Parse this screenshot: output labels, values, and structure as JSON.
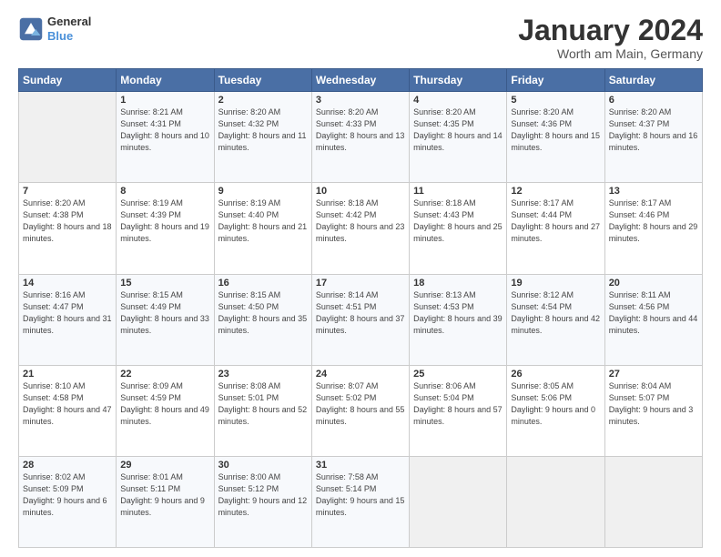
{
  "header": {
    "logo_line1": "General",
    "logo_line2": "Blue",
    "month_title": "January 2024",
    "location": "Worth am Main, Germany"
  },
  "days_of_week": [
    "Sunday",
    "Monday",
    "Tuesday",
    "Wednesday",
    "Thursday",
    "Friday",
    "Saturday"
  ],
  "weeks": [
    [
      {
        "day": "",
        "sunrise": "",
        "sunset": "",
        "daylight": "",
        "empty": true
      },
      {
        "day": "1",
        "sunrise": "Sunrise: 8:21 AM",
        "sunset": "Sunset: 4:31 PM",
        "daylight": "Daylight: 8 hours and 10 minutes."
      },
      {
        "day": "2",
        "sunrise": "Sunrise: 8:20 AM",
        "sunset": "Sunset: 4:32 PM",
        "daylight": "Daylight: 8 hours and 11 minutes."
      },
      {
        "day": "3",
        "sunrise": "Sunrise: 8:20 AM",
        "sunset": "Sunset: 4:33 PM",
        "daylight": "Daylight: 8 hours and 13 minutes."
      },
      {
        "day": "4",
        "sunrise": "Sunrise: 8:20 AM",
        "sunset": "Sunset: 4:35 PM",
        "daylight": "Daylight: 8 hours and 14 minutes."
      },
      {
        "day": "5",
        "sunrise": "Sunrise: 8:20 AM",
        "sunset": "Sunset: 4:36 PM",
        "daylight": "Daylight: 8 hours and 15 minutes."
      },
      {
        "day": "6",
        "sunrise": "Sunrise: 8:20 AM",
        "sunset": "Sunset: 4:37 PM",
        "daylight": "Daylight: 8 hours and 16 minutes."
      }
    ],
    [
      {
        "day": "7",
        "sunrise": "Sunrise: 8:20 AM",
        "sunset": "Sunset: 4:38 PM",
        "daylight": "Daylight: 8 hours and 18 minutes."
      },
      {
        "day": "8",
        "sunrise": "Sunrise: 8:19 AM",
        "sunset": "Sunset: 4:39 PM",
        "daylight": "Daylight: 8 hours and 19 minutes."
      },
      {
        "day": "9",
        "sunrise": "Sunrise: 8:19 AM",
        "sunset": "Sunset: 4:40 PM",
        "daylight": "Daylight: 8 hours and 21 minutes."
      },
      {
        "day": "10",
        "sunrise": "Sunrise: 8:18 AM",
        "sunset": "Sunset: 4:42 PM",
        "daylight": "Daylight: 8 hours and 23 minutes."
      },
      {
        "day": "11",
        "sunrise": "Sunrise: 8:18 AM",
        "sunset": "Sunset: 4:43 PM",
        "daylight": "Daylight: 8 hours and 25 minutes."
      },
      {
        "day": "12",
        "sunrise": "Sunrise: 8:17 AM",
        "sunset": "Sunset: 4:44 PM",
        "daylight": "Daylight: 8 hours and 27 minutes."
      },
      {
        "day": "13",
        "sunrise": "Sunrise: 8:17 AM",
        "sunset": "Sunset: 4:46 PM",
        "daylight": "Daylight: 8 hours and 29 minutes."
      }
    ],
    [
      {
        "day": "14",
        "sunrise": "Sunrise: 8:16 AM",
        "sunset": "Sunset: 4:47 PM",
        "daylight": "Daylight: 8 hours and 31 minutes."
      },
      {
        "day": "15",
        "sunrise": "Sunrise: 8:15 AM",
        "sunset": "Sunset: 4:49 PM",
        "daylight": "Daylight: 8 hours and 33 minutes."
      },
      {
        "day": "16",
        "sunrise": "Sunrise: 8:15 AM",
        "sunset": "Sunset: 4:50 PM",
        "daylight": "Daylight: 8 hours and 35 minutes."
      },
      {
        "day": "17",
        "sunrise": "Sunrise: 8:14 AM",
        "sunset": "Sunset: 4:51 PM",
        "daylight": "Daylight: 8 hours and 37 minutes."
      },
      {
        "day": "18",
        "sunrise": "Sunrise: 8:13 AM",
        "sunset": "Sunset: 4:53 PM",
        "daylight": "Daylight: 8 hours and 39 minutes."
      },
      {
        "day": "19",
        "sunrise": "Sunrise: 8:12 AM",
        "sunset": "Sunset: 4:54 PM",
        "daylight": "Daylight: 8 hours and 42 minutes."
      },
      {
        "day": "20",
        "sunrise": "Sunrise: 8:11 AM",
        "sunset": "Sunset: 4:56 PM",
        "daylight": "Daylight: 8 hours and 44 minutes."
      }
    ],
    [
      {
        "day": "21",
        "sunrise": "Sunrise: 8:10 AM",
        "sunset": "Sunset: 4:58 PM",
        "daylight": "Daylight: 8 hours and 47 minutes."
      },
      {
        "day": "22",
        "sunrise": "Sunrise: 8:09 AM",
        "sunset": "Sunset: 4:59 PM",
        "daylight": "Daylight: 8 hours and 49 minutes."
      },
      {
        "day": "23",
        "sunrise": "Sunrise: 8:08 AM",
        "sunset": "Sunset: 5:01 PM",
        "daylight": "Daylight: 8 hours and 52 minutes."
      },
      {
        "day": "24",
        "sunrise": "Sunrise: 8:07 AM",
        "sunset": "Sunset: 5:02 PM",
        "daylight": "Daylight: 8 hours and 55 minutes."
      },
      {
        "day": "25",
        "sunrise": "Sunrise: 8:06 AM",
        "sunset": "Sunset: 5:04 PM",
        "daylight": "Daylight: 8 hours and 57 minutes."
      },
      {
        "day": "26",
        "sunrise": "Sunrise: 8:05 AM",
        "sunset": "Sunset: 5:06 PM",
        "daylight": "Daylight: 9 hours and 0 minutes."
      },
      {
        "day": "27",
        "sunrise": "Sunrise: 8:04 AM",
        "sunset": "Sunset: 5:07 PM",
        "daylight": "Daylight: 9 hours and 3 minutes."
      }
    ],
    [
      {
        "day": "28",
        "sunrise": "Sunrise: 8:02 AM",
        "sunset": "Sunset: 5:09 PM",
        "daylight": "Daylight: 9 hours and 6 minutes."
      },
      {
        "day": "29",
        "sunrise": "Sunrise: 8:01 AM",
        "sunset": "Sunset: 5:11 PM",
        "daylight": "Daylight: 9 hours and 9 minutes."
      },
      {
        "day": "30",
        "sunrise": "Sunrise: 8:00 AM",
        "sunset": "Sunset: 5:12 PM",
        "daylight": "Daylight: 9 hours and 12 minutes."
      },
      {
        "day": "31",
        "sunrise": "Sunrise: 7:58 AM",
        "sunset": "Sunset: 5:14 PM",
        "daylight": "Daylight: 9 hours and 15 minutes."
      },
      {
        "day": "",
        "sunrise": "",
        "sunset": "",
        "daylight": "",
        "empty": true
      },
      {
        "day": "",
        "sunrise": "",
        "sunset": "",
        "daylight": "",
        "empty": true
      },
      {
        "day": "",
        "sunrise": "",
        "sunset": "",
        "daylight": "",
        "empty": true
      }
    ]
  ]
}
